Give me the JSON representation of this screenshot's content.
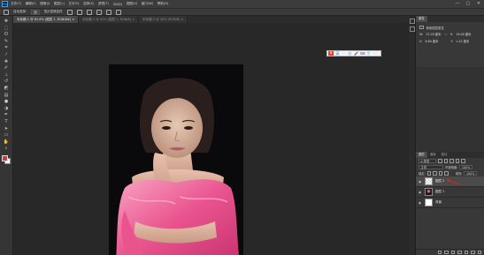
{
  "app": {
    "logo": "Ps",
    "menu": [
      "文件(F)",
      "编辑(E)",
      "图像(I)",
      "图层(L)",
      "文字(Y)",
      "选择(S)",
      "滤镜(T)",
      "3D(D)",
      "视图(V)",
      "窗口(W)",
      "帮助(H)"
    ],
    "window_controls": [
      "—",
      "▢",
      "✕"
    ]
  },
  "options_bar": {
    "items": [
      "自动选择:",
      "组",
      "显示变换控件"
    ]
  },
  "tabs": [
    {
      "label": "未标题-1 @ 82.6% (图层 1, RGB/8#) ×",
      "active": true
    },
    {
      "label": "未标题-2 @ 50% (图层 1, RGB/8) ×",
      "active": false
    },
    {
      "label": "未标题-3 @ 50% (RGB/8) ×",
      "active": false
    }
  ],
  "toolbar": {
    "tools": [
      "move-tool",
      "marquee-tool",
      "lasso-tool",
      "quick-select-tool",
      "crop-tool",
      "eyedropper-tool",
      "healing-brush-tool",
      "brush-tool",
      "clone-stamp-tool",
      "history-brush-tool",
      "eraser-tool",
      "gradient-tool",
      "blur-tool",
      "dodge-tool",
      "pen-tool",
      "type-tool",
      "path-select-tool",
      "rectangle-tool",
      "hand-tool",
      "zoom-tool"
    ],
    "foreground_color": "#e8303a",
    "background_color": "#ffffff"
  },
  "float_toolbar": {
    "logo": "S",
    "icons": [
      "英",
      "·",
      "☺",
      "🎤",
      "⌨",
      "👕",
      "⋯"
    ]
  },
  "properties_panel": {
    "tab": "属性",
    "section": "像素图层属性",
    "w_label": "W:",
    "w_value": "12.28 厘米",
    "h_label": "H:",
    "h_value": "16.00 厘米",
    "x_label": "X:",
    "x_value": "6.80 厘米",
    "y_label": "Y:",
    "y_value": "1.42 厘米"
  },
  "layers_panel": {
    "tabs": [
      {
        "label": "图层",
        "active": true
      },
      {
        "label": "通道",
        "active": false
      },
      {
        "label": "路径",
        "active": false
      }
    ],
    "kind_filter": "ρ 类型",
    "blend_mode": "正常",
    "opacity_label": "不透明度:",
    "opacity_value": "100%",
    "lock_label": "锁定:",
    "fill_label": "填充:",
    "fill_value": "100%",
    "layers": [
      {
        "name": "图层 2",
        "visible": true,
        "selected": true
      },
      {
        "name": "图层 1",
        "visible": true,
        "selected": false
      },
      {
        "name": "背景",
        "visible": true,
        "selected": false
      }
    ],
    "annotation_arrow_color": "#e02020"
  }
}
